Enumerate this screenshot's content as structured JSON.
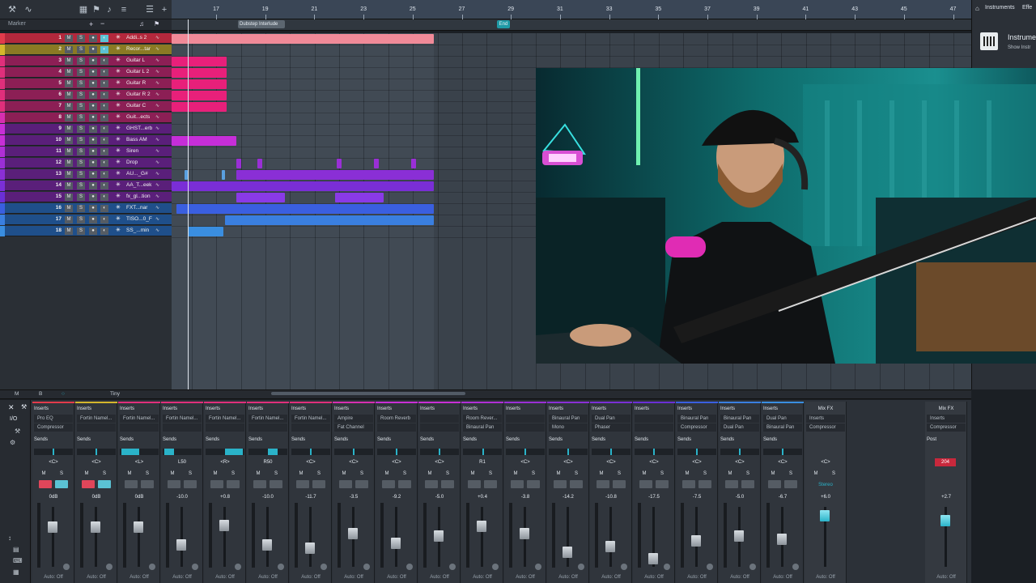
{
  "toolbar": {
    "icons": [
      "wrench-icon",
      "curve-icon",
      "grid-icon",
      "flag-icon",
      "music-icon",
      "bars-icon",
      "list-icon",
      "plus-icon"
    ]
  },
  "marker_header": {
    "label": "Marker"
  },
  "ruler": {
    "bars": [
      "17",
      "19",
      "21",
      "23",
      "25",
      "27",
      "29",
      "31",
      "33",
      "35",
      "37",
      "39",
      "41",
      "43",
      "45",
      "47"
    ]
  },
  "markers": {
    "section": "Dubstep Interlude",
    "end": "End"
  },
  "tracks": [
    {
      "num": "1",
      "name": "Addi..s 2",
      "color": "#e23b4b"
    },
    {
      "num": "2",
      "name": "Recor...tar",
      "color": "#d4b62c"
    },
    {
      "num": "3",
      "name": "Guitar L",
      "color": "#e02f7b"
    },
    {
      "num": "4",
      "name": "Guitar L 2",
      "color": "#e02f7b"
    },
    {
      "num": "5",
      "name": "Guitar R",
      "color": "#e02f7b"
    },
    {
      "num": "6",
      "name": "Guitar R 2",
      "color": "#e02f7b"
    },
    {
      "num": "7",
      "name": "Guitar C",
      "color": "#e02f7b"
    },
    {
      "num": "8",
      "name": "Guit...ects",
      "color": "#d62fb0"
    },
    {
      "num": "9",
      "name": "GHST...erb",
      "color": "#c82fd6"
    },
    {
      "num": "10",
      "name": "Bass AM",
      "color": "#c82fd6"
    },
    {
      "num": "11",
      "name": "Siren",
      "color": "#b02fd6"
    },
    {
      "num": "12",
      "name": "Drop",
      "color": "#9a2fd6"
    },
    {
      "num": "13",
      "name": "AU..._G#",
      "color": "#8a2fd6"
    },
    {
      "num": "14",
      "name": "AA_T...eek",
      "color": "#7a2fd6"
    },
    {
      "num": "15",
      "name": "fx_gl...tion",
      "color": "#6a2fd6"
    },
    {
      "num": "16",
      "name": "FXT...nar",
      "color": "#3a5fe0"
    },
    {
      "num": "17",
      "name": "TISO...0_F",
      "color": "#3a7fe0"
    },
    {
      "num": "18",
      "name": "SS_...min",
      "color": "#3a8ee0"
    }
  ],
  "track_buttons": {
    "mute": "M",
    "solo": "S"
  },
  "right_panel": {
    "tab_instruments": "Instruments",
    "tab_effects": "Effe",
    "title": "Instrume",
    "subtitle": "Show Instr"
  },
  "statusbar": {
    "m": "M",
    "b": "B",
    "zoom": "Tiny"
  },
  "mixer": {
    "io_label": "I/O",
    "inserts_label": "Inserts",
    "sends_label": "Sends",
    "auto_label": "Auto: Off",
    "mute": "M",
    "solo": "S",
    "channels": [
      {
        "color": "#e23b4b",
        "slot1": "Pro EQ",
        "slot2": "Compressor",
        "pan": "<C>",
        "vol": "0dB",
        "rec": true
      },
      {
        "color": "#d4b62c",
        "slot1": "Fortin Namel...",
        "slot2": "",
        "pan": "<C>",
        "vol": "0dB",
        "rec": true
      },
      {
        "color": "#e02f7b",
        "slot1": "Fortin Namel...",
        "slot2": "",
        "pan": "<L>",
        "vol": "0dB",
        "rec": false
      },
      {
        "color": "#e02f7b",
        "slot1": "Fortin Namel...",
        "slot2": "",
        "pan": "L50",
        "vol": "-10.0",
        "rec": false
      },
      {
        "color": "#e02f7b",
        "slot1": "Fortin Namel...",
        "slot2": "",
        "pan": "<R>",
        "vol": "+0.8",
        "rec": false
      },
      {
        "color": "#e02f7b",
        "slot1": "Fortin Namel...",
        "slot2": "",
        "pan": "R50",
        "vol": "-10.0",
        "rec": false
      },
      {
        "color": "#e02f7b",
        "slot1": "Fortin Namel...",
        "slot2": "",
        "pan": "<C>",
        "vol": "-11.7",
        "rec": false
      },
      {
        "color": "#d62fb0",
        "slot1": "Ampire",
        "slot2": "Fat Channel",
        "pan": "<C>",
        "vol": "-3.5",
        "rec": false
      },
      {
        "color": "#c82fd6",
        "slot1": "Room Reverb",
        "slot2": "",
        "pan": "<C>",
        "vol": "-9.2",
        "rec": false
      },
      {
        "color": "#c82fd6",
        "slot1": "",
        "slot2": "",
        "pan": "<C>",
        "vol": "-5.0",
        "rec": false
      },
      {
        "color": "#b02fd6",
        "slot1": "Room Rever...",
        "slot2": "Binaural Pan",
        "pan": "R1",
        "vol": "+0.4",
        "rec": false
      },
      {
        "color": "#9a2fd6",
        "slot1": "",
        "slot2": "",
        "pan": "<C>",
        "vol": "-3.8",
        "rec": false
      },
      {
        "color": "#8a2fd6",
        "slot1": "Binaural Pan",
        "slot2": "Mono",
        "pan": "<C>",
        "vol": "-14.2",
        "rec": false
      },
      {
        "color": "#7a2fd6",
        "slot1": "Dual Pan",
        "slot2": "Phaser",
        "pan": "<C>",
        "vol": "-10.8",
        "rec": false
      },
      {
        "color": "#6a2fd6",
        "slot1": "",
        "slot2": "",
        "pan": "<C>",
        "vol": "-17.5",
        "rec": false
      },
      {
        "color": "#3a5fe0",
        "slot1": "Binaural Pan",
        "slot2": "Compressor",
        "pan": "<C>",
        "vol": "-7.5",
        "rec": false
      },
      {
        "color": "#3a7fe0",
        "slot1": "Binaural Pan",
        "slot2": "Dual Pan",
        "pan": "<C>",
        "vol": "-5.0",
        "rec": false
      },
      {
        "color": "#3a8ee0",
        "slot1": "Dual Pan",
        "slot2": "Binaural Pan",
        "pan": "<C>",
        "vol": "-6.7",
        "rec": false
      }
    ],
    "fx": {
      "title": "Mix FX",
      "slot1": "Compressor",
      "pan": "<C>",
      "stereo": "Stereo",
      "vol": "+6.0"
    },
    "master": {
      "title": "Mix FX",
      "slot1": "Compressor",
      "post": "Post",
      "peak": "204",
      "vol": "+2.7"
    }
  }
}
